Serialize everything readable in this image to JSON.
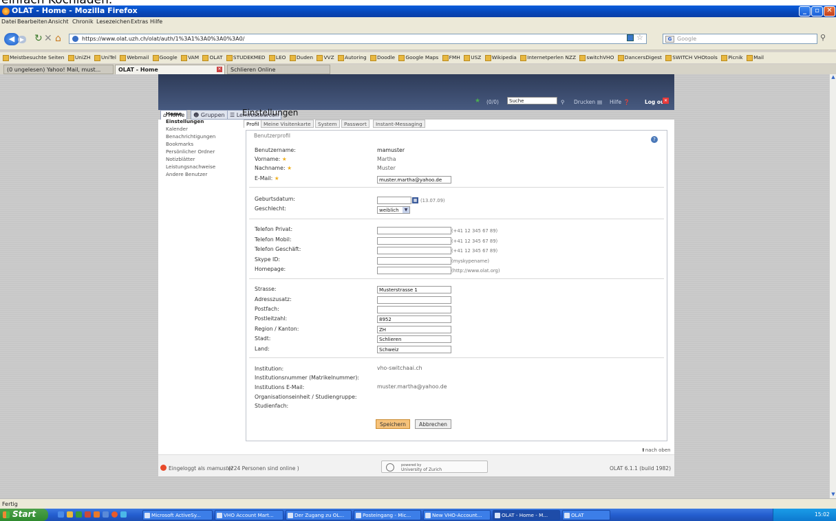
{
  "top_text": "einfach Kochladen.",
  "window": {
    "title": "OLAT - Home - Mozilla Firefox"
  },
  "menubar": [
    "Datei",
    "Bearbeiten",
    "Ansicht",
    "Chronik",
    "Lesezeichen",
    "Extras",
    "Hilfe"
  ],
  "nav": {
    "url": "https://www.olat.uzh.ch/olat/auth/1%3A1%3A0%3A0%3A0/",
    "search_placeholder": "Google",
    "search_engine": "G"
  },
  "bookmarks": [
    "Meistbesuchte Seiten",
    "UniZH",
    "UniTel",
    "Webmail",
    "Google",
    "VAM",
    "OLAT",
    "STUDEKMED",
    "LEO",
    "Duden",
    "VVZ",
    "Autoring",
    "Doodle",
    "Google Maps",
    "FMH",
    "USZ",
    "Wikipedia",
    "Internetperlen NZZ",
    "switchVHO",
    "DancersDigest",
    "SWITCH VHOtools",
    "Picnik",
    "Mail"
  ],
  "browser_tabs": [
    "(0 ungelesen) Yahoo! Mail, must...",
    "OLAT - Home",
    "Schlieren Online"
  ],
  "olat": {
    "header": {
      "counter": "(0/0)",
      "search_value": "Suche",
      "print": "Drucken",
      "help": "Hilfe",
      "logout": "Log out"
    },
    "main_tabs": [
      "Home",
      "Gruppen",
      "Lernressourcen"
    ],
    "left_menu": [
      "Home",
      "Einstellungen",
      "Kalender",
      "Benachrichtigungen",
      "Bookmarks",
      "Persönlicher Ordner",
      "Notizblätter",
      "Leistungsnachweise",
      "Andere Benutzer"
    ],
    "page_title": "Einstellungen",
    "sub_tabs": [
      "Profil",
      "Meine Visitenkarte",
      "System",
      "Passwort",
      "Instant-Messaging"
    ],
    "legend": "Benutzerprofil",
    "fields": {
      "username_label": "Benutzername:",
      "username": "mamuster",
      "firstname_label": "Vorname:",
      "firstname": "Martha",
      "lastname_label": "Nachname:",
      "lastname": "Muster",
      "email_label": "E-Mail:",
      "email": "muster.martha@yahoo.de",
      "birthdate_label": "Geburtsdatum:",
      "birthdate_hint": "(13.07.09)",
      "gender_label": "Geschlecht:",
      "gender": "weiblich",
      "phone_private_label": "Telefon Privat:",
      "phone_mobile_label": "Telefon Mobil:",
      "phone_business_label": "Telefon Geschäft:",
      "phone_hint": "(+41 12 345 67 89)",
      "skype_label": "Skype ID:",
      "skype_hint": "(myskypename)",
      "homepage_label": "Homepage:",
      "homepage_hint": "(http://www.olat.org)",
      "street_label": "Strasse:",
      "street": "Musterstrasse 1",
      "addr_extra_label": "Adresszusatz:",
      "pobox_label": "Postfach:",
      "zip_label": "Postleitzahl:",
      "zip": "8952",
      "region_label": "Region / Kanton:",
      "region": "ZH",
      "city_label": "Stadt:",
      "city": "Schlieren",
      "country_label": "Land:",
      "country": "Schweiz",
      "institution_label": "Institution:",
      "institution": "vho-switchaai.ch",
      "inst_number_label": "Institutionsnummer (Matrikelnummer):",
      "inst_email_label": "Institutions E-Mail:",
      "inst_email": "muster.martha@yahoo.de",
      "org_unit_label": "Organisationseinheit / Studiengruppe:",
      "subject_label": "Studienfach:"
    },
    "buttons": {
      "save": "Speichern",
      "cancel": "Abbrechen"
    },
    "top_link": "nach oben",
    "footer": {
      "logged_in": "Eingeloggt als",
      "user": "mamuster",
      "online": "(224 Personen sind online )",
      "powered1": "powered by",
      "powered2": "University of Zurich",
      "version": "OLAT 6.1.1 (build 1982)"
    }
  },
  "statusbar": "Fertig",
  "taskbar": {
    "start": "Start",
    "tasks": [
      "Microsoft ActiveSy...",
      "VHO Account Mart...",
      "Der Zugang zu OL...",
      "Posteingang - Mic...",
      "New VHO-Account...",
      "OLAT - Home - M...",
      "OLAT"
    ],
    "clock": "15:02"
  },
  "colors": {
    "olat_header": "#3a4a6a",
    "save_button": "#f6c27a",
    "required_star": "#f0b020",
    "xp_taskbar": "#245ed0"
  }
}
